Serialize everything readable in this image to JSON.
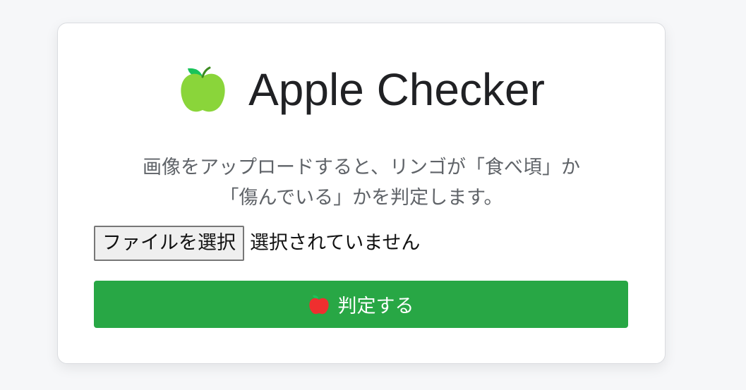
{
  "app": {
    "title": "Apple Checker",
    "description_lines": [
      "画像をアップロードすると、リンゴが「食べ頃」か",
      "「傷んでいる」かを判定します。"
    ]
  },
  "upload": {
    "file_button_label": "ファイルを選択",
    "file_status": "選択されていません"
  },
  "actions": {
    "submit_label": "判定する"
  },
  "icons": {
    "title": "green-apple-icon",
    "submit": "red-apple-icon"
  },
  "colors": {
    "page_background": "#f6f7f9",
    "card_background": "#ffffff",
    "accent_green": "#28a745",
    "green_apple": "#8ad53a",
    "red_apple": "#ef2f2f"
  }
}
